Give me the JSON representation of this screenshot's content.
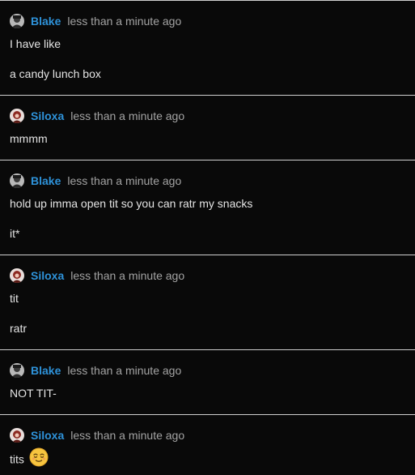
{
  "messages": [
    {
      "author": "Blake",
      "avatar": "blake-avatar",
      "time": "less than a minute ago",
      "lines": [
        "I have like",
        "a candy lunch box"
      ]
    },
    {
      "author": "Siloxa",
      "avatar": "siloxa-avatar",
      "time": "less than a minute ago",
      "lines": [
        "mmmm"
      ]
    },
    {
      "author": "Blake",
      "avatar": "blake-avatar",
      "time": "less than a minute ago",
      "lines": [
        "hold up imma open tit so you can ratr my snacks",
        "it*"
      ]
    },
    {
      "author": "Siloxa",
      "avatar": "siloxa-avatar",
      "time": "less than a minute ago",
      "lines": [
        "tit",
        "ratr"
      ]
    },
    {
      "author": "Blake",
      "avatar": "blake-avatar",
      "time": "less than a minute ago",
      "lines": [
        "NOT TIT-"
      ]
    },
    {
      "author": "Siloxa",
      "avatar": "siloxa-avatar",
      "time": "less than a minute ago",
      "lines": [
        "tits"
      ],
      "emoji": "smiling-relieved-face-emoji"
    }
  ],
  "colors": {
    "background": "#090909",
    "divider": "#cfcfcf",
    "username": "#2e92d9",
    "timestamp": "#a3a3a3",
    "text": "#e4e4e4"
  }
}
